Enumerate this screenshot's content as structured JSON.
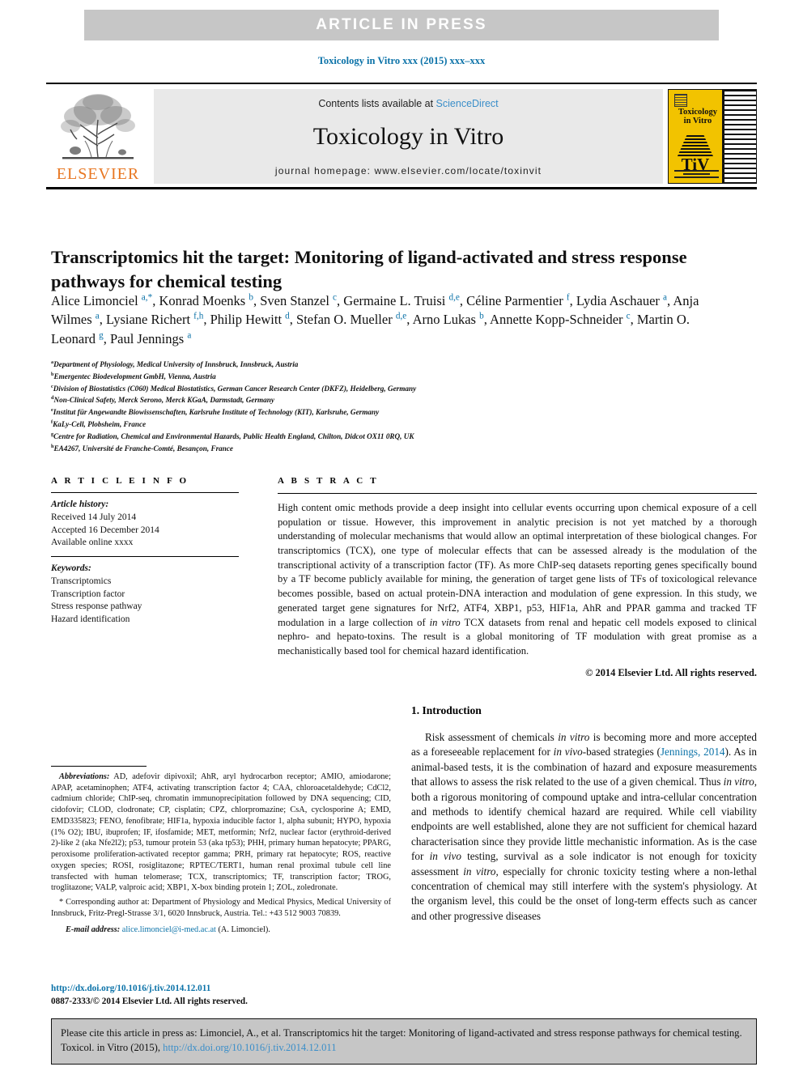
{
  "banner": {
    "text": "ARTICLE IN PRESS"
  },
  "journal_ref": "Toxicology in Vitro xxx (2015) xxx–xxx",
  "masthead": {
    "publisher": "ELSEVIER",
    "contents_prefix": "Contents lists available at ",
    "contents_link": "ScienceDirect",
    "journal_title": "Toxicology in Vitro",
    "homepage": "journal homepage: www.elsevier.com/locate/toxinvit",
    "cover": {
      "title_line1": "Toxicology",
      "title_line2": "in Vitro",
      "monogram": "TiV"
    }
  },
  "article": {
    "title": "Transcriptomics hit the target: Monitoring of ligand-activated and stress response pathways for chemical testing",
    "authors": [
      {
        "name": "Alice Limonciel",
        "sup": "a,*",
        "sep": ", "
      },
      {
        "name": "Konrad Moenks",
        "sup": "b",
        "sep": ", "
      },
      {
        "name": "Sven Stanzel",
        "sup": "c",
        "sep": ", "
      },
      {
        "name": "Germaine L. Truisi",
        "sup": "d,e",
        "sep": ", "
      },
      {
        "name": "Céline Parmentier",
        "sup": "f",
        "sep": ", "
      },
      {
        "name": "Lydia Aschauer",
        "sup": "a",
        "sep": ", "
      },
      {
        "name": "Anja Wilmes",
        "sup": "a",
        "sep": ", "
      },
      {
        "name": "Lysiane Richert",
        "sup": "f,h",
        "sep": ", "
      },
      {
        "name": "Philip Hewitt",
        "sup": "d",
        "sep": ", "
      },
      {
        "name": "Stefan O. Mueller",
        "sup": "d,e",
        "sep": ", "
      },
      {
        "name": "Arno Lukas",
        "sup": "b",
        "sep": ", "
      },
      {
        "name": "Annette Kopp-Schneider",
        "sup": "c",
        "sep": ", "
      },
      {
        "name": "Martin O. Leonard",
        "sup": "g",
        "sep": ", "
      },
      {
        "name": "Paul Jennings",
        "sup": "a",
        "sep": ""
      }
    ],
    "affiliations": [
      {
        "sup": "a",
        "text": "Department of Physiology, Medical University of Innsbruck, Innsbruck, Austria"
      },
      {
        "sup": "b",
        "text": "Emergentec Biodevelopment GmbH, Vienna, Austria"
      },
      {
        "sup": "c",
        "text": "Division of Biostatistics (C060) Medical Biostatistics, German Cancer Research Center (DKFZ), Heidelberg, Germany"
      },
      {
        "sup": "d",
        "text": "Non-Clinical Safety, Merck Serono, Merck KGaA, Darmstadt, Germany"
      },
      {
        "sup": "e",
        "text": "Institut für Angewandte Biowissenschaften, Karlsruhe Institute of Technology (KIT), Karlsruhe, Germany"
      },
      {
        "sup": "f",
        "text": "KaLy-Cell, Plobsheim, France"
      },
      {
        "sup": "g",
        "text": "Centre for Radiation, Chemical and Environmental Hazards, Public Health England, Chilton, Didcot OX11 0RQ, UK"
      },
      {
        "sup": "h",
        "text": "EA4267, Université de Franche-Comté, Besançon, France"
      }
    ]
  },
  "article_info": {
    "heading": "A R T I C L E   I N F O",
    "history_label": "Article history:",
    "history": [
      "Received 14 July 2014",
      "Accepted 16 December 2014",
      "Available online xxxx"
    ],
    "keywords_label": "Keywords:",
    "keywords": [
      "Transcriptomics",
      "Transcription factor",
      "Stress response pathway",
      "Hazard identification"
    ]
  },
  "abstract": {
    "heading": "A B S T R A C T",
    "text": "High content omic methods provide a deep insight into cellular events occurring upon chemical exposure of a cell population or tissue. However, this improvement in analytic precision is not yet matched by a thorough understanding of molecular mechanisms that would allow an optimal interpretation of these biological changes. For transcriptomics (TCX), one type of molecular effects that can be assessed already is the modulation of the transcriptional activity of a transcription factor (TF). As more ChIP-seq datasets reporting genes specifically bound by a TF become publicly available for mining, the generation of target gene lists of TFs of toxicological relevance becomes possible, based on actual protein-DNA interaction and modulation of gene expression. In this study, we generated target gene signatures for Nrf2, ATF4, XBP1, p53, HIF1a, AhR and PPAR gamma and tracked TF modulation in a large collection of in vitro TCX datasets from renal and hepatic cell models exposed to clinical nephro- and hepato-toxins. The result is a global monitoring of TF modulation with great promise as a mechanistically based tool for chemical hazard identification.",
    "italic_fragment": "in vitro",
    "copyright": "© 2014 Elsevier Ltd. All rights reserved."
  },
  "footnotes": {
    "abbreviations_label": "Abbreviations:",
    "abbreviations_text": " AD, adefovir dipivoxil; AhR, aryl hydrocarbon receptor; AMIO, amiodarone; APAP, acetaminophen; ATF4, activating transcription factor 4; CAA, chloroacetaldehyde; CdCl2, cadmium chloride; ChIP-seq, chromatin immunoprecipitation followed by DNA sequencing; CID, cidofovir; CLOD, clodronate; CP, cisplatin; CPZ, chlorpromazine; CsA, cyclosporine A; EMD, EMD335823; FENO, fenofibrate; HIF1a, hypoxia inducible factor 1, alpha subunit; HYPO, hypoxia (1% O2); IBU, ibuprofen; IF, ifosfamide; MET, metformin; Nrf2, nuclear factor (erythroid-derived 2)-like 2 (aka Nfe2l2); p53, tumour protein 53 (aka tp53); PHH, primary human hepatocyte; PPARG, peroxisome proliferation-activated receptor gamma; PRH, primary rat hepatocyte; ROS, reactive oxygen species; ROSI, rosiglitazone; RPTEC/TERT1, human renal proximal tubule cell line transfected with human telomerase; TCX, transcriptomics; TF, transcription factor; TROG, troglitazone; VALP, valproic acid; XBP1, X-box binding protein 1; ZOL, zoledronate.",
    "corresponding_marker": "*",
    "corresponding_text": " Corresponding author at: Department of Physiology and Medical Physics, Medical University of Innsbruck, Fritz-Pregl-Strasse 3/1, 6020 Innsbruck, Austria. Tel.: +43 512 9003 70839.",
    "email_label": "E-mail address:",
    "email": "alice.limonciel@i-med.ac.at",
    "email_suffix": " (A. Limonciel)."
  },
  "doi_block": {
    "doi_url": "http://dx.doi.org/10.1016/j.tiv.2014.12.011",
    "issn_line": "0887-2333/© 2014 Elsevier Ltd. All rights reserved."
  },
  "introduction": {
    "heading": "1. Introduction",
    "paragraph_part1": "Risk assessment of chemicals ",
    "italic1": "in vitro",
    "paragraph_part2": " is becoming more and more accepted as a foreseeable replacement for ",
    "italic2": "in vivo",
    "paragraph_part3": "-based strategies (",
    "citation": "Jennings, 2014",
    "paragraph_part4": "). As in animal-based tests, it is the combination of hazard and exposure measurements that allows to assess the risk related to the use of a given chemical. Thus ",
    "italic3": "in vitro",
    "paragraph_part5": ", both a rigorous monitoring of compound uptake and intra-cellular concentration and methods to identify chemical hazard are required. While cell viability endpoints are well established, alone they are not sufficient for chemical hazard characterisation since they provide little mechanistic information. As is the case for ",
    "italic4": "in vivo",
    "paragraph_part6": " testing, survival as a sole indicator is not enough for toxicity assessment ",
    "italic5": "in vitro",
    "paragraph_part7": ", especially for chronic toxicity testing where a non-lethal concentration of chemical may still interfere with the system's physiology. At the organism level, this could be the onset of long-term effects such as cancer and other progressive diseases"
  },
  "cite_footer": {
    "text_part1": "Please cite this article in press as: Limonciel, A., et al. Transcriptomics hit the target: Monitoring of ligand-activated and stress response pathways for chemical testing. Toxicol. in Vitro (2015), ",
    "link": "http://dx.doi.org/10.1016/j.tiv.2014.12.011"
  },
  "colors": {
    "link_blue": "#0b72a8",
    "science_direct_blue": "#3a8ec9",
    "elsevier_orange": "#e87722",
    "banner_gray": "#c6c6c6",
    "cover_yellow": "#f2c300"
  }
}
